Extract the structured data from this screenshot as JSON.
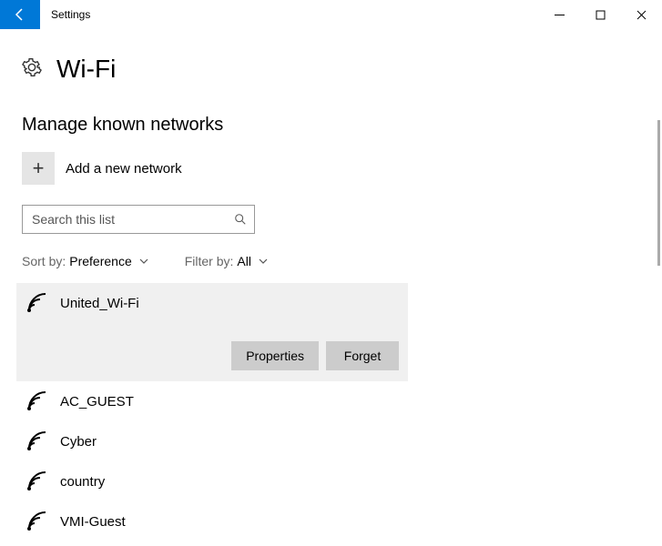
{
  "window": {
    "title": "Settings"
  },
  "page": {
    "title": "Wi-Fi",
    "subheading": "Manage known networks",
    "addNetworkLabel": "Add a new network"
  },
  "search": {
    "placeholder": "Search this list"
  },
  "sort": {
    "label": "Sort by:",
    "value": "Preference"
  },
  "filter": {
    "label": "Filter by:",
    "value": "All"
  },
  "actions": {
    "properties": "Properties",
    "forget": "Forget"
  },
  "networks": [
    {
      "name": "United_Wi-Fi",
      "selected": true
    },
    {
      "name": "AC_GUEST",
      "selected": false
    },
    {
      "name": "Cyber",
      "selected": false
    },
    {
      "name": "country",
      "selected": false
    },
    {
      "name": "VMI-Guest",
      "selected": false
    }
  ]
}
